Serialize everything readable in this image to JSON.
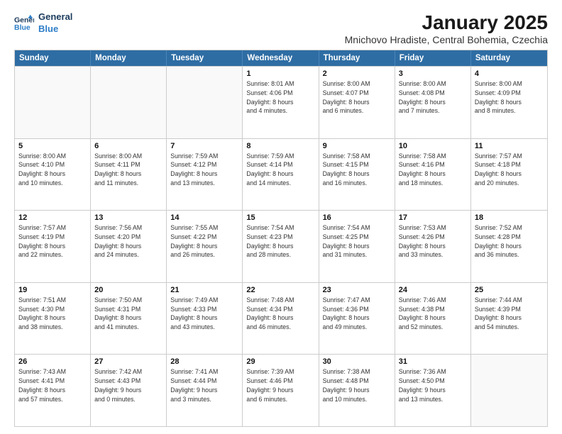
{
  "logo": {
    "line1": "General",
    "line2": "Blue"
  },
  "title": "January 2025",
  "subtitle": "Mnichovo Hradiste, Central Bohemia, Czechia",
  "header_days": [
    "Sunday",
    "Monday",
    "Tuesday",
    "Wednesday",
    "Thursday",
    "Friday",
    "Saturday"
  ],
  "weeks": [
    [
      {
        "day": "",
        "info": ""
      },
      {
        "day": "",
        "info": ""
      },
      {
        "day": "",
        "info": ""
      },
      {
        "day": "1",
        "info": "Sunrise: 8:01 AM\nSunset: 4:06 PM\nDaylight: 8 hours\nand 4 minutes."
      },
      {
        "day": "2",
        "info": "Sunrise: 8:00 AM\nSunset: 4:07 PM\nDaylight: 8 hours\nand 6 minutes."
      },
      {
        "day": "3",
        "info": "Sunrise: 8:00 AM\nSunset: 4:08 PM\nDaylight: 8 hours\nand 7 minutes."
      },
      {
        "day": "4",
        "info": "Sunrise: 8:00 AM\nSunset: 4:09 PM\nDaylight: 8 hours\nand 8 minutes."
      }
    ],
    [
      {
        "day": "5",
        "info": "Sunrise: 8:00 AM\nSunset: 4:10 PM\nDaylight: 8 hours\nand 10 minutes."
      },
      {
        "day": "6",
        "info": "Sunrise: 8:00 AM\nSunset: 4:11 PM\nDaylight: 8 hours\nand 11 minutes."
      },
      {
        "day": "7",
        "info": "Sunrise: 7:59 AM\nSunset: 4:12 PM\nDaylight: 8 hours\nand 13 minutes."
      },
      {
        "day": "8",
        "info": "Sunrise: 7:59 AM\nSunset: 4:14 PM\nDaylight: 8 hours\nand 14 minutes."
      },
      {
        "day": "9",
        "info": "Sunrise: 7:58 AM\nSunset: 4:15 PM\nDaylight: 8 hours\nand 16 minutes."
      },
      {
        "day": "10",
        "info": "Sunrise: 7:58 AM\nSunset: 4:16 PM\nDaylight: 8 hours\nand 18 minutes."
      },
      {
        "day": "11",
        "info": "Sunrise: 7:57 AM\nSunset: 4:18 PM\nDaylight: 8 hours\nand 20 minutes."
      }
    ],
    [
      {
        "day": "12",
        "info": "Sunrise: 7:57 AM\nSunset: 4:19 PM\nDaylight: 8 hours\nand 22 minutes."
      },
      {
        "day": "13",
        "info": "Sunrise: 7:56 AM\nSunset: 4:20 PM\nDaylight: 8 hours\nand 24 minutes."
      },
      {
        "day": "14",
        "info": "Sunrise: 7:55 AM\nSunset: 4:22 PM\nDaylight: 8 hours\nand 26 minutes."
      },
      {
        "day": "15",
        "info": "Sunrise: 7:54 AM\nSunset: 4:23 PM\nDaylight: 8 hours\nand 28 minutes."
      },
      {
        "day": "16",
        "info": "Sunrise: 7:54 AM\nSunset: 4:25 PM\nDaylight: 8 hours\nand 31 minutes."
      },
      {
        "day": "17",
        "info": "Sunrise: 7:53 AM\nSunset: 4:26 PM\nDaylight: 8 hours\nand 33 minutes."
      },
      {
        "day": "18",
        "info": "Sunrise: 7:52 AM\nSunset: 4:28 PM\nDaylight: 8 hours\nand 36 minutes."
      }
    ],
    [
      {
        "day": "19",
        "info": "Sunrise: 7:51 AM\nSunset: 4:30 PM\nDaylight: 8 hours\nand 38 minutes."
      },
      {
        "day": "20",
        "info": "Sunrise: 7:50 AM\nSunset: 4:31 PM\nDaylight: 8 hours\nand 41 minutes."
      },
      {
        "day": "21",
        "info": "Sunrise: 7:49 AM\nSunset: 4:33 PM\nDaylight: 8 hours\nand 43 minutes."
      },
      {
        "day": "22",
        "info": "Sunrise: 7:48 AM\nSunset: 4:34 PM\nDaylight: 8 hours\nand 46 minutes."
      },
      {
        "day": "23",
        "info": "Sunrise: 7:47 AM\nSunset: 4:36 PM\nDaylight: 8 hours\nand 49 minutes."
      },
      {
        "day": "24",
        "info": "Sunrise: 7:46 AM\nSunset: 4:38 PM\nDaylight: 8 hours\nand 52 minutes."
      },
      {
        "day": "25",
        "info": "Sunrise: 7:44 AM\nSunset: 4:39 PM\nDaylight: 8 hours\nand 54 minutes."
      }
    ],
    [
      {
        "day": "26",
        "info": "Sunrise: 7:43 AM\nSunset: 4:41 PM\nDaylight: 8 hours\nand 57 minutes."
      },
      {
        "day": "27",
        "info": "Sunrise: 7:42 AM\nSunset: 4:43 PM\nDaylight: 9 hours\nand 0 minutes."
      },
      {
        "day": "28",
        "info": "Sunrise: 7:41 AM\nSunset: 4:44 PM\nDaylight: 9 hours\nand 3 minutes."
      },
      {
        "day": "29",
        "info": "Sunrise: 7:39 AM\nSunset: 4:46 PM\nDaylight: 9 hours\nand 6 minutes."
      },
      {
        "day": "30",
        "info": "Sunrise: 7:38 AM\nSunset: 4:48 PM\nDaylight: 9 hours\nand 10 minutes."
      },
      {
        "day": "31",
        "info": "Sunrise: 7:36 AM\nSunset: 4:50 PM\nDaylight: 9 hours\nand 13 minutes."
      },
      {
        "day": "",
        "info": ""
      }
    ]
  ]
}
